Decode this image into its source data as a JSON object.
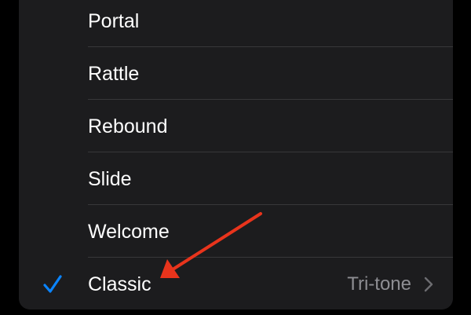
{
  "sounds": {
    "items": [
      {
        "label": "Portal"
      },
      {
        "label": "Rattle"
      },
      {
        "label": "Rebound"
      },
      {
        "label": "Slide"
      },
      {
        "label": "Welcome"
      }
    ],
    "selected": {
      "label": "Classic",
      "detail": "Tri-tone"
    }
  },
  "icons": {
    "check": "checkmark-icon",
    "chevron": "chevron-right-icon",
    "arrow": "red-annotation-arrow"
  },
  "colors": {
    "panel_background": "#1c1c1e",
    "text_primary": "#ffffff",
    "text_secondary": "#8e8e93",
    "accent_check": "#0a84ff",
    "annotation_arrow": "#e8341c"
  }
}
